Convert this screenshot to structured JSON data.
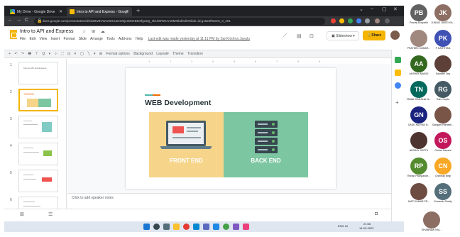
{
  "browser": {
    "tabs": [
      {
        "title": "My Drive - Google Drive",
        "active": false
      },
      {
        "title": "Intro to API and Express - Googl",
        "active": true
      }
    ],
    "new_tab": "+",
    "window_controls": [
      "⌄",
      "–",
      "▢",
      "✕"
    ],
    "url": "docs.google.com/presentation/d/1bZ9wBVWce9GXaOzWjz4kMKBDSfgu5Q_sk1lWR9nAm8MMbd/edit#slide=id.g1625f9a0c5_0_201",
    "nav": {
      "back": "←",
      "forward": "→",
      "reload": "C"
    }
  },
  "app": {
    "doc_title": "Intro to API and Express",
    "title_icons": "☆ ⊞ ☁",
    "menu": [
      "File",
      "Edit",
      "View",
      "Insert",
      "Format",
      "Slide",
      "Arrange",
      "Tools",
      "Add-ons",
      "Help"
    ],
    "last_edit": "Last edit was made yesterday at 11:11 PM by Sai Krishna Jayalu",
    "slideshow_label": "Slideshow",
    "share_label": "Share",
    "share_icon": "lock-icon",
    "toolbar": [
      "+",
      "↶",
      "↷",
      "🖶",
      "⊤",
      "Q",
      "▾",
      "⊹",
      "⛶",
      "⊡",
      "▾",
      "◯",
      "╲",
      "▾",
      "⊞",
      "Format options",
      "Background",
      "Layout▾",
      "Theme",
      "Transition"
    ],
    "ruler_ticks": [
      "1",
      "2",
      "3",
      "4",
      "5",
      "6",
      "7",
      "8",
      "9"
    ],
    "speaker_notes_placeholder": "Click to add speaker notes"
  },
  "filmstrip": {
    "slides": [
      {
        "num": "1",
        "title": "Intro to API and Express",
        "selected": false
      },
      {
        "num": "2",
        "title": "",
        "selected": true
      },
      {
        "num": "3",
        "title": "",
        "selected": false
      },
      {
        "num": "4",
        "title": "",
        "selected": false
      },
      {
        "num": "5",
        "title": "",
        "selected": false
      },
      {
        "num": "6",
        "title": "",
        "selected": false
      }
    ]
  },
  "slide": {
    "heading": "WEB Development",
    "front_label": "FRONT END",
    "back_label": "BACK END",
    "colors": {
      "front_panel": "#f6d58a",
      "back_panel": "#7cc6a1",
      "accent_teal": "#4db6ac",
      "accent_orange": "#ef6c00"
    }
  },
  "taskbar": {
    "icons": [
      "windows-start-icon",
      "search-icon",
      "task-view-icon",
      "file-explorer-icon",
      "chrome-icon",
      "mail-icon",
      "store-icon",
      "vscode-icon",
      "edge-icon",
      "teams-icon",
      "slack-icon"
    ],
    "tray_lang": "ENG IN",
    "tray_time": "21:56",
    "tray_date": "14-03-2022"
  },
  "participants": [
    {
      "initials": "PB",
      "name": "Pranay Boopathi",
      "color": "#616161",
      "photo": false
    },
    {
      "initials": "JK",
      "name": "JUNAID JAVED KA...",
      "color": "#8d6e63",
      "photo": false
    },
    {
      "initials": "",
      "name": "PRATEEK KUMAR...",
      "color": "#a1887f",
      "photo": true
    },
    {
      "initials": "PK",
      "name": "P KARTHIKA",
      "color": "#3f51b5",
      "photo": false
    },
    {
      "initials": "AA",
      "name": "AKSHAY ANAND",
      "color": "#33691e",
      "photo": false
    },
    {
      "initials": "",
      "name": "Saurabh Dey",
      "color": "#5d4037",
      "photo": true
    },
    {
      "initials": "TN",
      "name": "TAMAL KANJILAL N...",
      "color": "#00695c",
      "photo": false
    },
    {
      "initials": "RG",
      "name": "Ram Gupta",
      "color": "#455a64",
      "photo": false
    },
    {
      "initials": "GN",
      "name": "GADE KALYAN N...",
      "color": "#1a237e",
      "photo": false
    },
    {
      "initials": "",
      "name": "Gangam Ramesh...",
      "color": "#795548",
      "photo": true
    },
    {
      "initials": "",
      "name": "AKSHAY GATTU",
      "color": "#4e342e",
      "photo": true
    },
    {
      "initials": "OS",
      "name": "Omkar Sawant",
      "color": "#c2185b",
      "photo": false
    },
    {
      "initials": "RP",
      "name": "Rohan Pachpande...",
      "color": "#558b2f",
      "photo": false
    },
    {
      "initials": "CN",
      "name": "Chinmay Negi",
      "color": "#f9a825",
      "photo": false
    },
    {
      "initials": "",
      "name": "AMIT KUMAR PR...",
      "color": "#6d4c41",
      "photo": true
    },
    {
      "initials": "SS",
      "name": "Sumanth Shetty",
      "color": "#546e7a",
      "photo": false
    },
    {
      "initials": "",
      "name": "SHUBHAM SHA...",
      "color": "#8d6e63",
      "photo": true
    }
  ]
}
